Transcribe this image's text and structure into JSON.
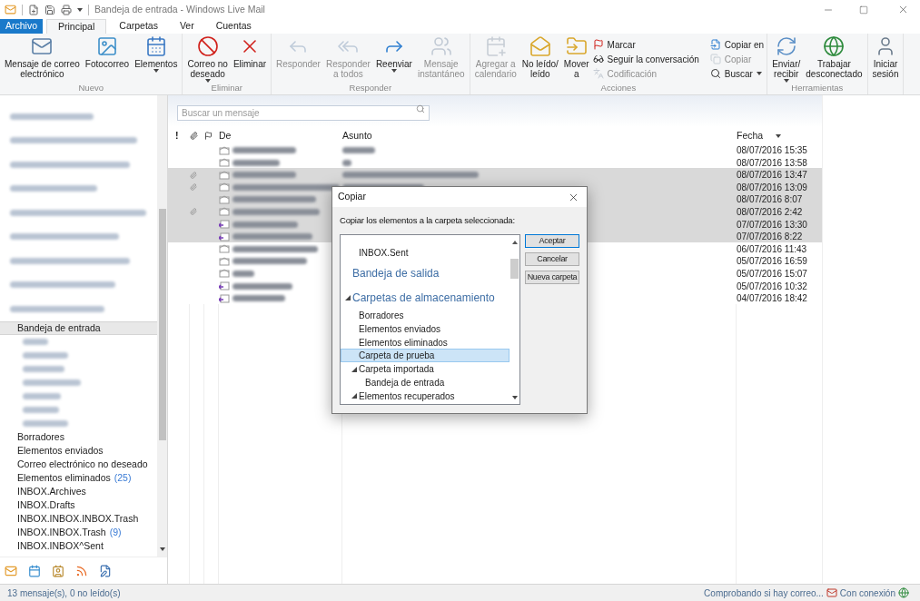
{
  "window": {
    "title": "Bandeja de entrada - Windows Live Mail"
  },
  "tabs": [
    {
      "label": "Archivo",
      "kind": "file",
      "selected": false
    },
    {
      "label": "Principal",
      "kind": "tab",
      "selected": true
    },
    {
      "label": "Carpetas",
      "kind": "tab",
      "selected": false
    },
    {
      "label": "Ver",
      "kind": "tab",
      "selected": false
    },
    {
      "label": "Cuentas",
      "kind": "tab",
      "selected": false
    }
  ],
  "ribbon": [
    {
      "label": "Nuevo",
      "items": [
        {
          "kind": "large",
          "label": "Mensaje de correo\nelectrónico",
          "disabled": false,
          "dropdown": false
        },
        {
          "kind": "large",
          "label": "Fotocorreo",
          "disabled": false,
          "dropdown": false
        },
        {
          "kind": "large",
          "label": "Elementos",
          "disabled": false,
          "dropdown": true
        }
      ]
    },
    {
      "label": "Eliminar",
      "items": [
        {
          "kind": "large",
          "label": "Correo no\ndeseado",
          "disabled": false,
          "dropdown": true
        },
        {
          "kind": "large",
          "label": "Eliminar",
          "disabled": false,
          "dropdown": false
        }
      ]
    },
    {
      "label": "Responder",
      "items": [
        {
          "kind": "large",
          "label": "Responder",
          "disabled": true,
          "dropdown": false
        },
        {
          "kind": "large",
          "label": "Responder\na todos",
          "disabled": true,
          "dropdown": false
        },
        {
          "kind": "large",
          "label": "Reenviar",
          "disabled": false,
          "dropdown": true
        },
        {
          "kind": "large",
          "label": "Mensaje\ninstantáneo",
          "disabled": true,
          "dropdown": false
        }
      ]
    },
    {
      "label": "Acciones",
      "items": [
        {
          "kind": "large",
          "label": "Agregar a\ncalendario",
          "disabled": true,
          "dropdown": false
        },
        {
          "kind": "large",
          "label": "No leído/\nleído",
          "disabled": false,
          "dropdown": false
        },
        {
          "kind": "large",
          "label": "Mover\na",
          "disabled": false,
          "dropdown": false
        },
        {
          "kind": "small",
          "label": "Marcar",
          "disabled": false,
          "dropdown": false
        },
        {
          "kind": "small",
          "label": "Seguir la conversación",
          "disabled": false,
          "dropdown": false
        },
        {
          "kind": "small",
          "label": "Codificación",
          "disabled": true,
          "dropdown": false
        },
        {
          "kind": "small",
          "label": "Copiar en",
          "disabled": false,
          "dropdown": false
        },
        {
          "kind": "small",
          "label": "Copiar",
          "disabled": true,
          "dropdown": false
        },
        {
          "kind": "small",
          "label": "Buscar",
          "disabled": false,
          "dropdown": true
        }
      ]
    },
    {
      "label": "Herramientas",
      "items": [
        {
          "kind": "large",
          "label": "Enviar/\nrecibir",
          "disabled": false,
          "dropdown": true
        },
        {
          "kind": "large",
          "label": "Trabajar\ndesconectado",
          "disabled": false,
          "dropdown": false
        }
      ]
    },
    {
      "items": [
        {
          "kind": "large",
          "label": "Iniciar\nsesión",
          "disabled": false,
          "dropdown": false
        }
      ]
    }
  ],
  "sidebar": {
    "accounts": [
      {
        "kind": "blurred"
      },
      {
        "kind": "blurred"
      },
      {
        "kind": "blurred"
      },
      {
        "kind": "blurred"
      },
      {
        "kind": "blurred"
      },
      {
        "kind": "blurred"
      },
      {
        "kind": "blurred"
      },
      {
        "kind": "blurred"
      },
      {
        "kind": "blurred"
      }
    ],
    "folders": [
      {
        "label": "Bandeja de entrada",
        "selected": true,
        "children": [
          {
            "kind": "blurred"
          },
          {
            "kind": "blurred"
          },
          {
            "kind": "blurred"
          },
          {
            "kind": "blurred"
          },
          {
            "kind": "blurred"
          },
          {
            "kind": "blurred"
          },
          {
            "kind": "blurred"
          }
        ]
      },
      {
        "label": "Borradores",
        "selected": false
      },
      {
        "label": "Elementos enviados",
        "selected": false
      },
      {
        "label": "Correo electrónico no deseado",
        "selected": false
      },
      {
        "label": "Elementos eliminados",
        "count": "(25)",
        "selected": false
      },
      {
        "label": "INBOX.Archives",
        "selected": false
      },
      {
        "label": "INBOX.Drafts",
        "selected": false
      },
      {
        "label": "INBOX.INBOX.INBOX.Trash",
        "selected": false
      },
      {
        "label": "INBOX.INBOX.Trash",
        "count": "(9)",
        "selected": false
      },
      {
        "label": "INBOX.INBOX^Sent",
        "selected": false
      }
    ]
  },
  "search": {
    "placeholder": "Buscar un mensaje"
  },
  "table": {
    "columns": [
      "!",
      "De",
      "Asunto",
      "Fecha"
    ],
    "rows": [
      {
        "kind": "read",
        "date": "08/07/2016 15:35",
        "selected": false,
        "attachment": false
      },
      {
        "kind": "read",
        "date": "08/07/2016 13:58",
        "selected": false,
        "attachment": false
      },
      {
        "kind": "read",
        "date": "08/07/2016 13:47",
        "selected": true,
        "attachment": true
      },
      {
        "kind": "read",
        "date": "08/07/2016 13:09",
        "selected": true,
        "attachment": true
      },
      {
        "kind": "read",
        "date": "08/07/2016 8:07",
        "selected": true,
        "attachment": false
      },
      {
        "kind": "read",
        "date": "08/07/2016 2:42",
        "selected": true,
        "attachment": true
      },
      {
        "kind": "forwarded",
        "date": "07/07/2016 13:30",
        "selected": true,
        "attachment": false
      },
      {
        "kind": "forwarded",
        "date": "07/07/2016 8:22",
        "selected": true,
        "attachment": false
      },
      {
        "kind": "read",
        "date": "06/07/2016 11:43",
        "selected": false,
        "attachment": false
      },
      {
        "kind": "read",
        "date": "05/07/2016 16:59",
        "selected": false,
        "attachment": false
      },
      {
        "kind": "read",
        "date": "05/07/2016 15:07",
        "selected": false,
        "attachment": false
      },
      {
        "kind": "forwarded",
        "date": "05/07/2016 10:32",
        "selected": false,
        "attachment": false
      },
      {
        "kind": "forwarded",
        "date": "04/07/2016 18:42",
        "selected": false,
        "attachment": false
      }
    ]
  },
  "dialog": {
    "title": "Copiar",
    "prompt": "Copiar los elementos a la carpeta seleccionada:",
    "tree": [
      {
        "kind": "folder",
        "label": "INBOX.Sent",
        "selected": false
      },
      {
        "kind": "account",
        "label": "Bandeja de salida",
        "selected": false
      },
      {
        "kind": "account",
        "label": "Carpetas de almacenamiento",
        "selected": false,
        "expanded": true,
        "children": [
          {
            "kind": "folder",
            "label": "Borradores",
            "selected": false
          },
          {
            "kind": "folder",
            "label": "Elementos enviados",
            "selected": false
          },
          {
            "kind": "folder",
            "label": "Elementos eliminados",
            "selected": false
          },
          {
            "kind": "folder",
            "label": "Carpeta de prueba",
            "selected": true
          },
          {
            "kind": "folder",
            "label": "Carpeta importada",
            "selected": false,
            "expanded": true,
            "children": [
              {
                "kind": "folder",
                "label": "Bandeja de entrada",
                "selected": false
              }
            ]
          },
          {
            "kind": "folder",
            "label": "Elementos recuperados",
            "selected": false,
            "expanded": true
          }
        ]
      }
    ],
    "buttons": [
      {
        "label": "Aceptar",
        "kind": "default"
      },
      {
        "label": "Cancelar",
        "kind": "normal"
      },
      {
        "label": "Nueva carpeta",
        "kind": "normal"
      }
    ]
  },
  "status_bar": {
    "left": "13 mensaje(s), 0 no leído(s)",
    "checking": "Comprobando si hay correo...",
    "connection": "Con conexión"
  }
}
